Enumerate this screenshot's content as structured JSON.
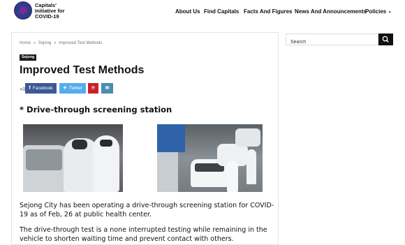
{
  "site": {
    "logo_lines": [
      "Capitals'",
      "Initiative for",
      "COVID-19"
    ]
  },
  "nav": {
    "items": [
      "About Us",
      "Find Capitals",
      "Facts And Figures",
      "News And Announcements",
      "Policies"
    ]
  },
  "breadcrumb": [
    "Home",
    "Sejong",
    "Improved Test Methods"
  ],
  "breadcrumb_sep": "»",
  "article": {
    "tag": "Sejong",
    "title": "Improved Test Methods",
    "subhead": "* Drive-through screening station",
    "paragraph1": " Sejong City has been operating a drive-through screening station for COVID-19 as of Feb, 26 at public health center.",
    "paragraph2": "  The drive-through test is a none interrupted testing while remaining in the vehicle to shorten waiting time and prevent contact with others."
  },
  "share": {
    "count": "0",
    "facebook_label": "Facebook",
    "twitter_label": "Twitter",
    "icons": [
      "facebook-icon",
      "twitter-icon",
      "pinterest-icon",
      "email-icon"
    ]
  },
  "search": {
    "placeholder": "Search",
    "button_icon": "search-icon"
  },
  "colors": {
    "facebook": "#3b5998",
    "twitter": "#55acee",
    "pinterest": "#cb2027",
    "email": "#4a8db4",
    "tag_bg": "#1a1a1a"
  }
}
